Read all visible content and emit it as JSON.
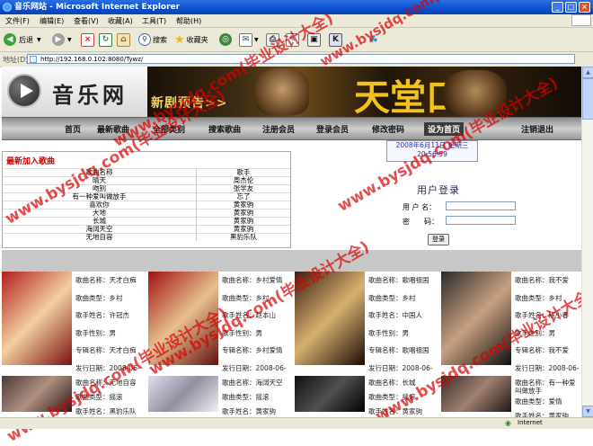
{
  "window": {
    "title": "音乐网站 - Microsoft Internet Explorer"
  },
  "menu": [
    "文件(F)",
    "编辑(E)",
    "查看(V)",
    "收藏(A)",
    "工具(T)",
    "帮助(H)"
  ],
  "toolbar": {
    "back": "后退",
    "search": "搜索",
    "favorites": "收藏夹"
  },
  "address": {
    "label": "地址(D)",
    "url": "http://192.168.0.102:8080/Tywz/"
  },
  "site": {
    "logo_text": "音乐网",
    "banner_sub": "新剧预告>>",
    "banner_big": "天堂口"
  },
  "nav": [
    "首页",
    "最新歌曲",
    "全部类别",
    "搜索歌曲",
    "注册会员",
    "登录会员",
    "修改密码",
    "设为首页",
    "注销退出"
  ],
  "recent": {
    "title": "最新加入歌曲",
    "headers": [
      "歌曲名称",
      "歌手"
    ],
    "rows": [
      [
        "晴天",
        "周杰伦"
      ],
      [
        "吻别",
        "张学友"
      ],
      [
        "有一种爱叫做放手",
        "忘了"
      ],
      [
        "喜欢你",
        "黄家驹"
      ],
      [
        "大地",
        "黄家驹"
      ],
      [
        "长城",
        "黄家驹"
      ],
      [
        "海阔天空",
        "黄家驹"
      ],
      [
        "无地自容",
        "黑豹乐队"
      ]
    ]
  },
  "datetime": {
    "date": "2008年6月11日 星期三",
    "time": "20:56:59"
  },
  "login": {
    "title": "用户登录",
    "user_label": "用 户 名：",
    "pwd_label": "密　　码：",
    "button": "登录"
  },
  "songs_row1": [
    {
      "name": "歌曲名称：天才白痴",
      "type": "歌曲类型：乡村",
      "singer": "歌手姓名：许冠杰",
      "sex": "歌手性别：男",
      "album": "专辑名称：天才白痴",
      "date": "发行日期：2008-06-"
    },
    {
      "name": "歌曲名称：乡村爱情",
      "type": "歌曲类型：乡村",
      "singer": "歌手姓名：赵本山",
      "sex": "歌手性别：男",
      "album": "专辑名称：乡村爱情",
      "date": "发行日期：2008-06-"
    },
    {
      "name": "歌曲名称：歌唱祖国",
      "type": "歌曲类型：乡村",
      "singer": "歌手姓名：中国人",
      "sex": "歌手性别：男",
      "album": "专辑名称：歌唱祖国",
      "date": "发行日期：2008-06-"
    },
    {
      "name": "歌曲名称：我不爱",
      "type": "歌曲类型：乡村",
      "singer": "歌手姓名：陈小春",
      "sex": "歌手性别：男",
      "album": "专辑名称：我不爱",
      "date": "发行日期：2008-06-"
    }
  ],
  "songs_row2": [
    {
      "name": "歌曲名称：无地自容",
      "type": "歌曲类型：摇滚",
      "singer": "歌手姓名：黑豹乐队"
    },
    {
      "name": "歌曲名称：海阔天空",
      "type": "歌曲类型：摇滚",
      "singer": "歌手姓名：黄家驹"
    },
    {
      "name": "歌曲名称：长城",
      "type": "歌曲类型：摇滚",
      "singer": "歌手姓名：黄家驹"
    },
    {
      "name": "歌曲名称：有一种爱叫做放手",
      "type": "歌曲类型：爱情",
      "singer": "歌手姓名：黄家驹"
    }
  ],
  "status": {
    "zone": "Internet"
  },
  "watermarks": [
    "www.bysjdq.com(毕业设计大全)"
  ],
  "colors": {
    "titlebar": "#0a4fd0",
    "accent_red": "#cc0000",
    "nav": "#a8a8a8"
  }
}
